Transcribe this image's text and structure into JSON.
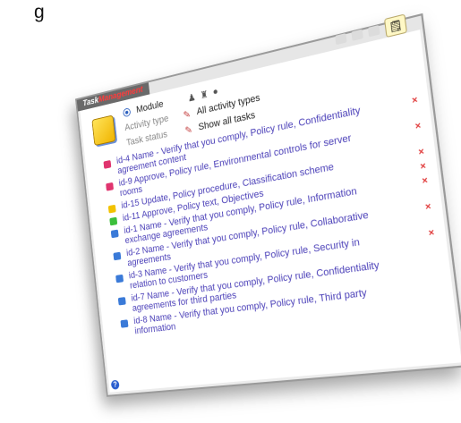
{
  "header_text": "g",
  "window": {
    "title_part1": "Task",
    "title_part2": "Management"
  },
  "filters": {
    "module_label": "Module",
    "activity_type_label": "Activity type",
    "activity_type_value": "All activity types",
    "task_status_label": "Task status",
    "task_status_value": "Show all tasks"
  },
  "tasks": [
    {
      "text": "id-4 Name - Verify that you comply, Policy rule, Confidentiality agreement content",
      "icon_color": "#e0356f",
      "deletable": true
    },
    {
      "text": "id-9 Approve, Policy rule, Environmental controls for server rooms",
      "icon_color": "#e0356f",
      "deletable": true
    },
    {
      "text": "id-15 Update, Policy procedure, Classification scheme",
      "icon_color": "#f2c200",
      "deletable": true
    },
    {
      "text": "id-11 Approve, Policy text, Objectives",
      "icon_color": "#3bbf3b",
      "deletable": true
    },
    {
      "text": "id-1 Name - Verify that you comply, Policy rule, Information exchange agreements",
      "icon_color": "#3a7ad8",
      "deletable": true
    },
    {
      "text": "id-2 Name - Verify that you comply, Policy rule, Collaborative agreements",
      "icon_color": "#3a7ad8",
      "deletable": true
    },
    {
      "text": "id-3 Name - Verify that you comply, Policy rule, Security in relation to customers",
      "icon_color": "#3a7ad8",
      "deletable": true
    },
    {
      "text": "id-7 Name - Verify that you comply, Policy rule, Confidentiality agreements for third parties",
      "icon_color": "#3a7ad8",
      "deletable": false
    },
    {
      "text": "id-8 Name - Verify that you comply, Policy rule, Third party information",
      "icon_color": "#3a7ad8",
      "deletable": false
    }
  ],
  "delete_glyph": "×",
  "help_glyph": "?",
  "colors": {
    "title_accent": "#ff3b3b",
    "link": "#4a3fb8",
    "delete": "#e03a3a"
  }
}
